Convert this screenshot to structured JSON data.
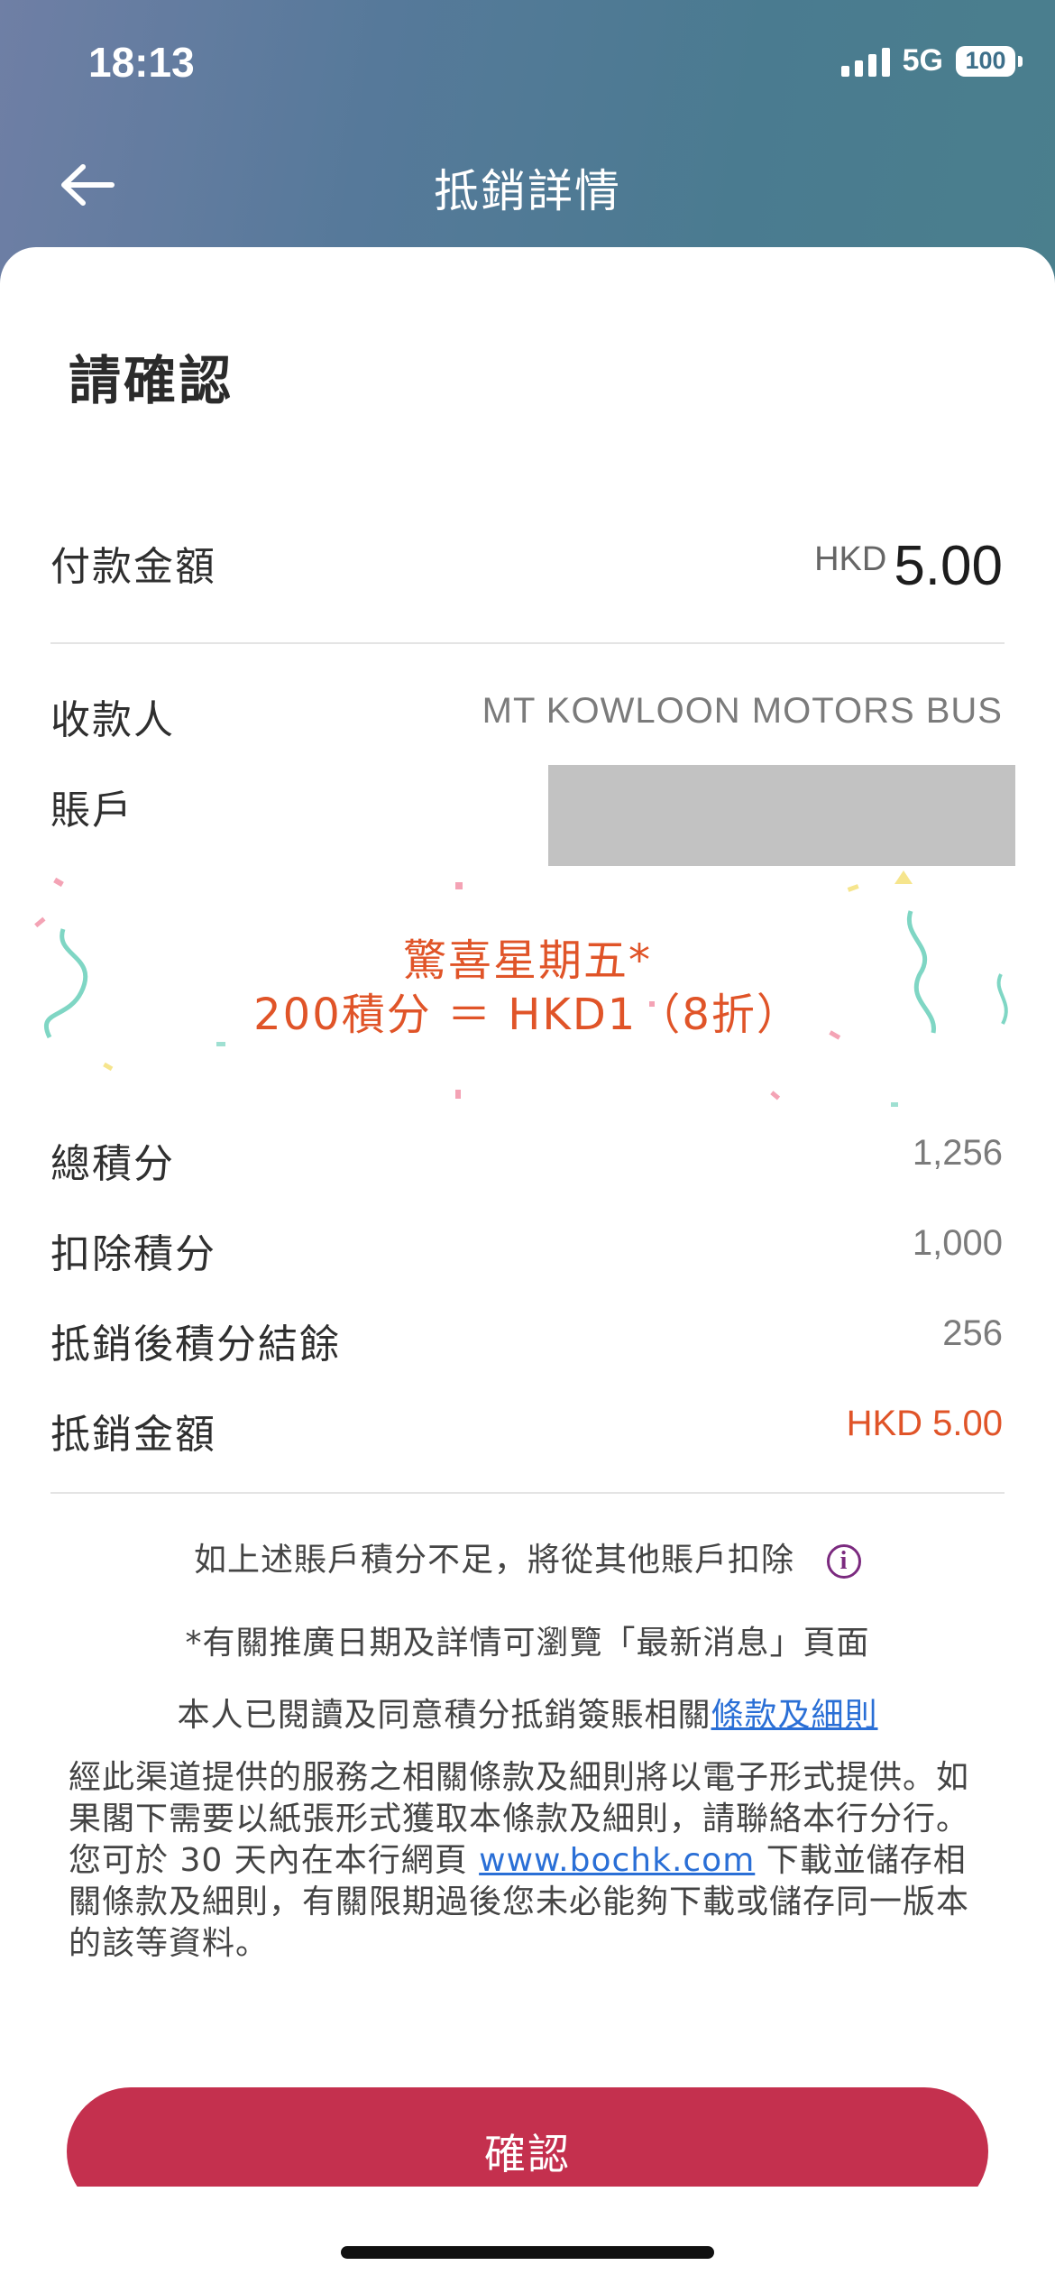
{
  "status_bar": {
    "time": "18:13",
    "network": "5G",
    "battery": "100"
  },
  "nav": {
    "title": "抵銷詳情",
    "back_icon": "back-arrow-icon"
  },
  "heading": "請確認",
  "payment": {
    "label": "付款金額",
    "currency": "HKD",
    "amount": "5.00"
  },
  "payee": {
    "label": "收款人",
    "value": "MT KOWLOON MOTORS BUS"
  },
  "account": {
    "label": "賬戶"
  },
  "promo": {
    "line1": "驚喜星期五*",
    "line2": "200積分 ＝ HKD1（8折）"
  },
  "points": [
    {
      "label": "總積分",
      "value": "1,256"
    },
    {
      "label": "扣除積分",
      "value": "1,000"
    },
    {
      "label": "抵銷後積分結餘",
      "value": "256"
    },
    {
      "label": "抵銷金額",
      "value": "HKD 5.00"
    }
  ],
  "notes": {
    "insufficient": "如上述賬戶積分不足，將從其他賬戶扣除",
    "promo_details": "*有關推廣日期及詳情可瀏覽「最新消息」頁面",
    "agree_prefix": "本人已閱讀及同意積分抵銷簽賬相關",
    "agree_link": "條款及細則"
  },
  "terms": {
    "part1": "經此渠道提供的服務之相關條款及細則將以電子形式提供。如果閣下需要以紙張形式獲取本條款及細則，請聯絡本行分行。",
    "part2_prefix": "您可於 30 天內在本行網頁 ",
    "link": "www.bochk.com",
    "part2_suffix": " 下載並儲存相關條款及細則，有關限期過後您未必能夠下載或儲存同一版本的該等資料。"
  },
  "confirm_label": "確認",
  "colors": {
    "accent": "#c4304e",
    "highlight": "#e05428",
    "link": "#2a6fd6",
    "info": "#7b2a7f"
  }
}
